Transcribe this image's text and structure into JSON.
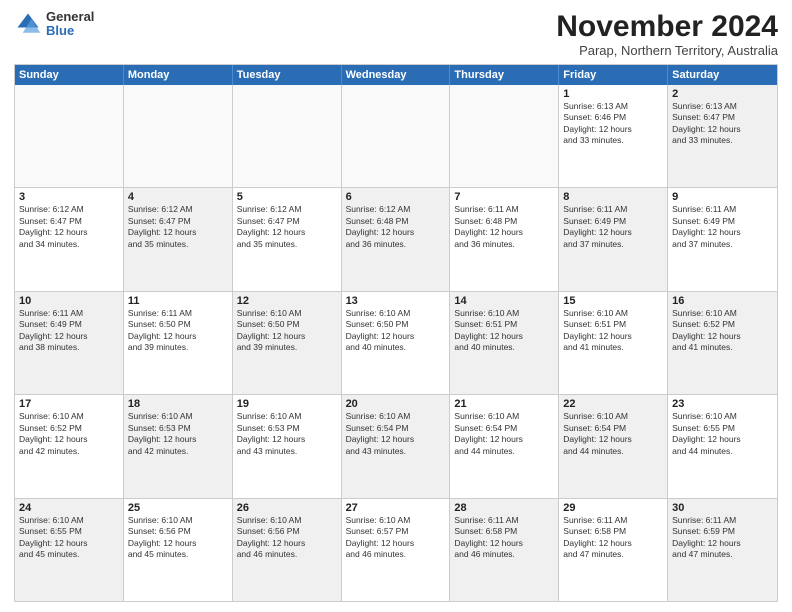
{
  "logo": {
    "general": "General",
    "blue": "Blue"
  },
  "header": {
    "month": "November 2024",
    "location": "Parap, Northern Territory, Australia"
  },
  "weekdays": [
    "Sunday",
    "Monday",
    "Tuesday",
    "Wednesday",
    "Thursday",
    "Friday",
    "Saturday"
  ],
  "weeks": [
    [
      {
        "day": "",
        "info": "",
        "empty": true
      },
      {
        "day": "",
        "info": "",
        "empty": true
      },
      {
        "day": "",
        "info": "",
        "empty": true
      },
      {
        "day": "",
        "info": "",
        "empty": true
      },
      {
        "day": "",
        "info": "",
        "empty": true
      },
      {
        "day": "1",
        "info": "Sunrise: 6:13 AM\nSunset: 6:46 PM\nDaylight: 12 hours\nand 33 minutes.",
        "empty": false
      },
      {
        "day": "2",
        "info": "Sunrise: 6:13 AM\nSunset: 6:47 PM\nDaylight: 12 hours\nand 33 minutes.",
        "empty": false,
        "shaded": true
      }
    ],
    [
      {
        "day": "3",
        "info": "Sunrise: 6:12 AM\nSunset: 6:47 PM\nDaylight: 12 hours\nand 34 minutes.",
        "empty": false
      },
      {
        "day": "4",
        "info": "Sunrise: 6:12 AM\nSunset: 6:47 PM\nDaylight: 12 hours\nand 35 minutes.",
        "empty": false,
        "shaded": true
      },
      {
        "day": "5",
        "info": "Sunrise: 6:12 AM\nSunset: 6:47 PM\nDaylight: 12 hours\nand 35 minutes.",
        "empty": false
      },
      {
        "day": "6",
        "info": "Sunrise: 6:12 AM\nSunset: 6:48 PM\nDaylight: 12 hours\nand 36 minutes.",
        "empty": false,
        "shaded": true
      },
      {
        "day": "7",
        "info": "Sunrise: 6:11 AM\nSunset: 6:48 PM\nDaylight: 12 hours\nand 36 minutes.",
        "empty": false
      },
      {
        "day": "8",
        "info": "Sunrise: 6:11 AM\nSunset: 6:49 PM\nDaylight: 12 hours\nand 37 minutes.",
        "empty": false,
        "shaded": true
      },
      {
        "day": "9",
        "info": "Sunrise: 6:11 AM\nSunset: 6:49 PM\nDaylight: 12 hours\nand 37 minutes.",
        "empty": false
      }
    ],
    [
      {
        "day": "10",
        "info": "Sunrise: 6:11 AM\nSunset: 6:49 PM\nDaylight: 12 hours\nand 38 minutes.",
        "empty": false,
        "shaded": true
      },
      {
        "day": "11",
        "info": "Sunrise: 6:11 AM\nSunset: 6:50 PM\nDaylight: 12 hours\nand 39 minutes.",
        "empty": false
      },
      {
        "day": "12",
        "info": "Sunrise: 6:10 AM\nSunset: 6:50 PM\nDaylight: 12 hours\nand 39 minutes.",
        "empty": false,
        "shaded": true
      },
      {
        "day": "13",
        "info": "Sunrise: 6:10 AM\nSunset: 6:50 PM\nDaylight: 12 hours\nand 40 minutes.",
        "empty": false
      },
      {
        "day": "14",
        "info": "Sunrise: 6:10 AM\nSunset: 6:51 PM\nDaylight: 12 hours\nand 40 minutes.",
        "empty": false,
        "shaded": true
      },
      {
        "day": "15",
        "info": "Sunrise: 6:10 AM\nSunset: 6:51 PM\nDaylight: 12 hours\nand 41 minutes.",
        "empty": false
      },
      {
        "day": "16",
        "info": "Sunrise: 6:10 AM\nSunset: 6:52 PM\nDaylight: 12 hours\nand 41 minutes.",
        "empty": false,
        "shaded": true
      }
    ],
    [
      {
        "day": "17",
        "info": "Sunrise: 6:10 AM\nSunset: 6:52 PM\nDaylight: 12 hours\nand 42 minutes.",
        "empty": false
      },
      {
        "day": "18",
        "info": "Sunrise: 6:10 AM\nSunset: 6:53 PM\nDaylight: 12 hours\nand 42 minutes.",
        "empty": false,
        "shaded": true
      },
      {
        "day": "19",
        "info": "Sunrise: 6:10 AM\nSunset: 6:53 PM\nDaylight: 12 hours\nand 43 minutes.",
        "empty": false
      },
      {
        "day": "20",
        "info": "Sunrise: 6:10 AM\nSunset: 6:54 PM\nDaylight: 12 hours\nand 43 minutes.",
        "empty": false,
        "shaded": true
      },
      {
        "day": "21",
        "info": "Sunrise: 6:10 AM\nSunset: 6:54 PM\nDaylight: 12 hours\nand 44 minutes.",
        "empty": false
      },
      {
        "day": "22",
        "info": "Sunrise: 6:10 AM\nSunset: 6:54 PM\nDaylight: 12 hours\nand 44 minutes.",
        "empty": false,
        "shaded": true
      },
      {
        "day": "23",
        "info": "Sunrise: 6:10 AM\nSunset: 6:55 PM\nDaylight: 12 hours\nand 44 minutes.",
        "empty": false
      }
    ],
    [
      {
        "day": "24",
        "info": "Sunrise: 6:10 AM\nSunset: 6:55 PM\nDaylight: 12 hours\nand 45 minutes.",
        "empty": false,
        "shaded": true
      },
      {
        "day": "25",
        "info": "Sunrise: 6:10 AM\nSunset: 6:56 PM\nDaylight: 12 hours\nand 45 minutes.",
        "empty": false
      },
      {
        "day": "26",
        "info": "Sunrise: 6:10 AM\nSunset: 6:56 PM\nDaylight: 12 hours\nand 46 minutes.",
        "empty": false,
        "shaded": true
      },
      {
        "day": "27",
        "info": "Sunrise: 6:10 AM\nSunset: 6:57 PM\nDaylight: 12 hours\nand 46 minutes.",
        "empty": false
      },
      {
        "day": "28",
        "info": "Sunrise: 6:11 AM\nSunset: 6:58 PM\nDaylight: 12 hours\nand 46 minutes.",
        "empty": false,
        "shaded": true
      },
      {
        "day": "29",
        "info": "Sunrise: 6:11 AM\nSunset: 6:58 PM\nDaylight: 12 hours\nand 47 minutes.",
        "empty": false
      },
      {
        "day": "30",
        "info": "Sunrise: 6:11 AM\nSunset: 6:59 PM\nDaylight: 12 hours\nand 47 minutes.",
        "empty": false,
        "shaded": true
      }
    ]
  ]
}
